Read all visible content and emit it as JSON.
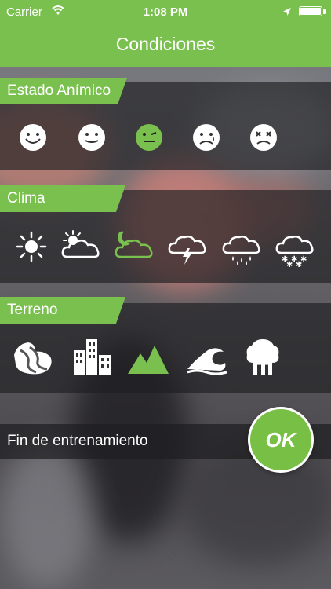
{
  "status_bar": {
    "carrier": "Carrier",
    "time": "1:08 PM"
  },
  "nav": {
    "title": "Condiciones"
  },
  "sections": {
    "mood": {
      "label": "Estado Anímico",
      "icons": [
        "very-happy-face-icon",
        "happy-face-icon",
        "neutral-face-icon",
        "sad-face-icon",
        "dizzy-face-icon"
      ],
      "selected_index": 2
    },
    "weather": {
      "label": "Clima",
      "icons": [
        "sun-icon",
        "sun-cloud-icon",
        "moon-cloud-icon",
        "storm-cloud-icon",
        "rain-cloud-icon",
        "snow-cloud-icon"
      ],
      "selected_index": 2
    },
    "terrain": {
      "label": "Terreno",
      "icons": [
        "road-terrain-icon",
        "city-buildings-icon",
        "mountains-icon",
        "waves-icon",
        "forest-trees-icon"
      ],
      "selected_index": 2
    }
  },
  "finish": {
    "label": "Fin de entrenamiento",
    "ok_label": "OK"
  },
  "colors": {
    "accent": "#7ac04e",
    "icon": "#ffffff",
    "panel": "rgba(30,30,33,0.66)"
  }
}
